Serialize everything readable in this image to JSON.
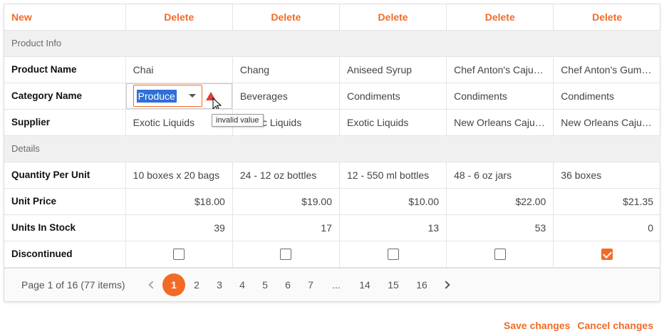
{
  "header": {
    "new_label": "New",
    "delete_label": "Delete"
  },
  "groups": {
    "product_info": "Product Info",
    "details": "Details"
  },
  "labels": {
    "product_name": "Product Name",
    "category_name": "Category Name",
    "supplier": "Supplier",
    "quantity_per_unit": "Quantity Per Unit",
    "unit_price": "Unit Price",
    "units_in_stock": "Units In Stock",
    "discontinued": "Discontinued"
  },
  "products": [
    {
      "name": "Chai",
      "category": "Produce",
      "supplier": "Exotic Liquids",
      "qty": "10 boxes x 20 bags",
      "price": "$18.00",
      "stock": "39",
      "discontinued": false
    },
    {
      "name": "Chang",
      "category": "Beverages",
      "supplier": "Exotic Liquids",
      "qty": "24 - 12 oz bottles",
      "price": "$19.00",
      "stock": "17",
      "discontinued": false
    },
    {
      "name": "Aniseed Syrup",
      "category": "Condiments",
      "supplier": "Exotic Liquids",
      "qty": "12 - 550 ml bottles",
      "price": "$10.00",
      "stock": "13",
      "discontinued": false
    },
    {
      "name": "Chef Anton's Cajun Seasoning",
      "category": "Condiments",
      "supplier": "New Orleans Cajun Delights",
      "qty": "48 - 6 oz jars",
      "price": "$22.00",
      "stock": "53",
      "discontinued": false
    },
    {
      "name": "Chef Anton's Gumbo Mix",
      "category": "Condiments",
      "supplier": "New Orleans Cajun Delights",
      "qty": "36 boxes",
      "price": "$21.35",
      "stock": "0",
      "discontinued": true
    }
  ],
  "editor": {
    "tooltip": "invalid value"
  },
  "pager": {
    "info": "Page 1 of 16 (77 items)",
    "pages": [
      "1",
      "2",
      "3",
      "4",
      "5",
      "6",
      "7",
      "...",
      "14",
      "15",
      "16"
    ],
    "current": "1"
  },
  "actions": {
    "save": "Save changes",
    "cancel": "Cancel changes"
  },
  "colors": {
    "accent": "#f26b26",
    "selection": "#2f6fd6",
    "error": "#e23b3b"
  }
}
